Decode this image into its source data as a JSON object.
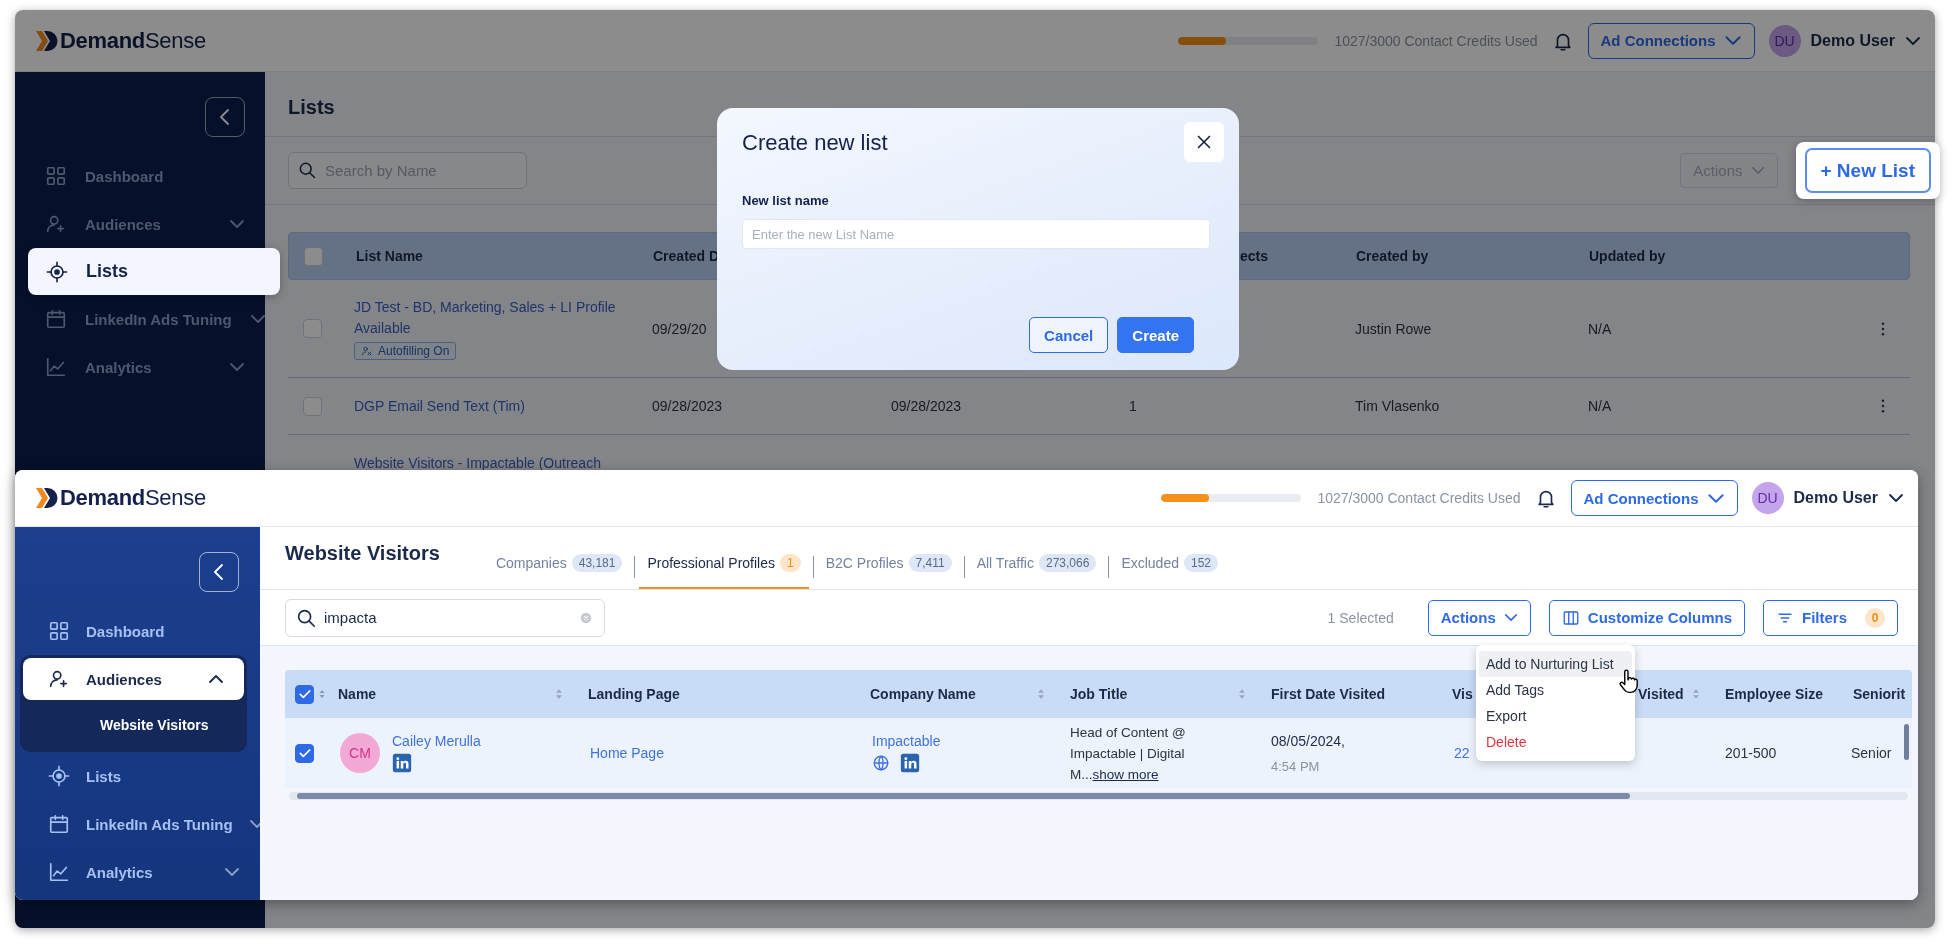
{
  "lists_window": {
    "header": {
      "brand": "**Demand**Sense",
      "credits": {
        "level": 0.34,
        "text": "1027/3000 Contact Credits Used"
      },
      "ad_button": "Ad Connections",
      "user": {
        "initials": "DU",
        "name": "Demo User"
      }
    },
    "sidebar": {
      "items": [
        {
          "label": "Dashboard",
          "selected": false
        },
        {
          "label": "Audiences",
          "selected": false,
          "expanded": false
        },
        {
          "label": "Lists",
          "selected": true
        },
        {
          "label": "LinkedIn Ads Tuning",
          "selected": false,
          "expanded": false
        },
        {
          "label": "Analytics",
          "selected": false,
          "expanded": false
        }
      ]
    },
    "page": {
      "title": "Lists",
      "search": {
        "placeholder": "Search by Name"
      },
      "actions_button": {
        "label": "Actions",
        "disabled": true
      },
      "new_list_button": "+ New List"
    },
    "table": {
      "all_checked": false,
      "columns": [
        "List Name",
        "Created D",
        "ects",
        "Created by",
        "Updated by"
      ],
      "rows": [
        {
          "checked": false,
          "list_name": "JD Test - BD, Marketing, Sales + LI Profile Available",
          "tag": "Autofilling On",
          "created": "09/29/20",
          "created_by": "Justin Rowe",
          "updated_by": "N/A",
          "menu": true
        },
        {
          "checked": false,
          "list_name": "DGP Email Send Text (Tim)",
          "created": "09/28/2023",
          "updated": "09/28/2023",
          "contacts": "1",
          "created_by": "Tim Vlasenko",
          "updated_by": "N/A",
          "menu": true
        },
        {
          "list_name": "Website Visitors - Impactable (Outreach"
        }
      ]
    },
    "dialog": {
      "title": "Create new list",
      "field_label": "New list name",
      "placeholder": "Enter the new List Name",
      "buttons": [
        {
          "label": "Cancel",
          "kind": "secondary"
        },
        {
          "label": "Create",
          "kind": "primary"
        }
      ]
    }
  },
  "visitors_window": {
    "header": {
      "brand": "**Demand**Sense",
      "credits": {
        "level": 0.34,
        "text": "1027/3000 Contact Credits Used"
      },
      "ad_button": "Ad Connections",
      "user": {
        "initials": "DU",
        "name": "Demo User"
      }
    },
    "sidebar": {
      "items": [
        {
          "label": "Dashboard",
          "selected": false
        },
        {
          "label": "Audiences",
          "selected": true,
          "expanded": true,
          "children": [
            {
              "label": "Website Visitors",
              "selected": true
            }
          ]
        },
        {
          "label": "Lists",
          "selected": false
        },
        {
          "label": "LinkedIn Ads Tuning",
          "selected": false,
          "expanded": false
        },
        {
          "label": "Analytics",
          "selected": false,
          "expanded": false
        }
      ]
    },
    "page": {
      "title": "Website Visitors",
      "tabs": [
        {
          "label": "Companies",
          "count": "43,181",
          "selected": false
        },
        {
          "label": "Professional Profiles",
          "count": "1",
          "selected": true
        },
        {
          "label": "B2C Profiles",
          "count": "7,411",
          "selected": false
        },
        {
          "label": "All Traffic",
          "count": "273,066",
          "selected": false
        },
        {
          "label": "Excluded",
          "count": "152",
          "selected": false
        }
      ],
      "search": {
        "value": "impacta"
      },
      "selected_count": "1 Selected",
      "actions_button": {
        "label": "Actions",
        "disabled": false
      },
      "customize_button": "Customize Columns",
      "filters_button": {
        "label": "Filters",
        "count": "0"
      }
    },
    "actions_menu": {
      "items": [
        {
          "label": "Add to Nurturing List",
          "kind": "normal",
          "highlighted": true
        },
        {
          "label": "Add Tags",
          "kind": "normal",
          "highlighted": false
        },
        {
          "label": "Export",
          "kind": "normal",
          "highlighted": false
        },
        {
          "label": "Delete",
          "kind": "danger",
          "highlighted": false
        }
      ]
    },
    "table": {
      "all_checked": true,
      "columns": [
        {
          "label": "Name",
          "sortable": true
        },
        {
          "label": "Landing Page",
          "sortable": false
        },
        {
          "label": "Company Name",
          "sortable": true
        },
        {
          "label": "Job Title",
          "sortable": true
        },
        {
          "label": "First Date Visited",
          "sortable": false
        },
        {
          "label": "Vis",
          "sortable": false
        },
        {
          "label": "Visited",
          "sortable": true
        },
        {
          "label": "Employee Size",
          "sortable": false
        },
        {
          "label": "Seniorit",
          "sortable": false
        }
      ],
      "rows": [
        {
          "checked": true,
          "initials": "CM",
          "name": "Cailey Merulla",
          "landing_page": "Home Page",
          "company": "Impactable",
          "job_title": "Head of Content @ Impactable | Digital M...",
          "job_more": "show more",
          "first_date": "08/05/2024,",
          "first_time": "4:54 PM",
          "visits": "22",
          "employee_size": "201-500",
          "seniority": "Senior"
        }
      ]
    }
  }
}
